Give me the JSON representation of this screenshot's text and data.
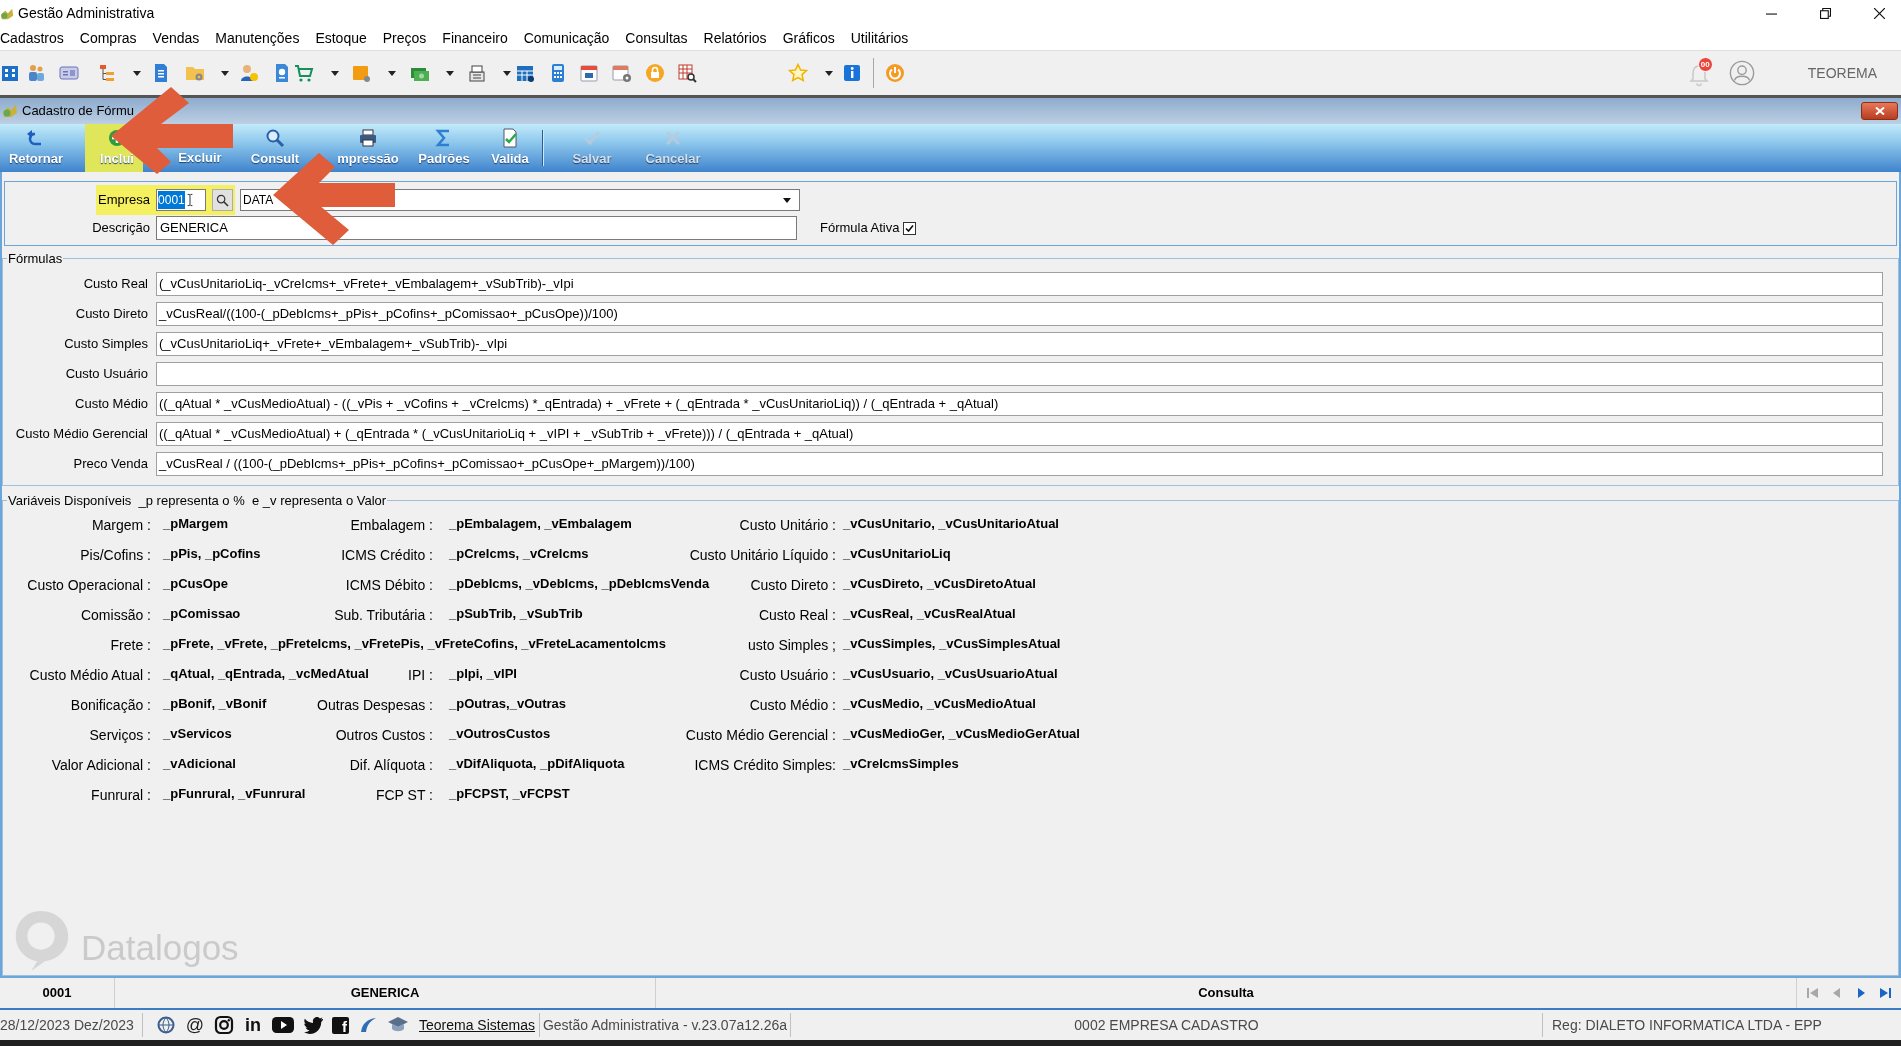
{
  "window": {
    "title": "Gestão Administrativa"
  },
  "menu": [
    "Cadastros",
    "Compras",
    "Vendas",
    "Manutenções",
    "Estoque",
    "Preços",
    "Financeiro",
    "Comunicação",
    "Consultas",
    "Relatórios",
    "Gráficos",
    "Utilitários"
  ],
  "header": {
    "notification_count": "00",
    "user": "TEOREMA"
  },
  "form_window": {
    "title": "Cadastro de Fórmu",
    "buttons": [
      {
        "label": "Retornar",
        "disabled": false,
        "annotated": false
      },
      {
        "label": "Inclui",
        "disabled": false,
        "annotated": true
      },
      {
        "label": "Excluir",
        "disabled": false,
        "annotated": false
      },
      {
        "label": "Consult",
        "disabled": false,
        "annotated": false
      },
      {
        "label": "mpressão",
        "disabled": false,
        "annotated": false
      },
      {
        "label": "Padrões",
        "disabled": false,
        "annotated": false
      },
      {
        "label": "Valida",
        "disabled": false,
        "annotated": false
      },
      {
        "label": "Salvar",
        "disabled": true,
        "annotated": false
      },
      {
        "label": "Cancelar",
        "disabled": true,
        "annotated": false
      }
    ]
  },
  "empresa": {
    "label": "Empresa",
    "code": "0001",
    "code_selected": true,
    "name": "DATA",
    "annotated": true
  },
  "descricao": {
    "label": "Descrição",
    "value": "GENERICA"
  },
  "formula_ativa": {
    "label": "Fórmula Ativa",
    "checked": true
  },
  "formulas": {
    "legend": "Fórmulas",
    "rows": [
      {
        "label": "Custo Real",
        "value": "(_vCusUnitarioLiq-_vCreIcms+_vFrete+_vEmbalagem+_vSubTrib)-_vIpi"
      },
      {
        "label": "Custo Direto",
        "value": "_vCusReal/((100-(_pDebIcms+_pPis+_pCofins+_pComissao+_pCusOpe))/100)"
      },
      {
        "label": "Custo Simples",
        "value": "(_vCusUnitarioLiq+_vFrete+_vEmbalagem+_vSubTrib)-_vIpi"
      },
      {
        "label": "Custo Usuário"
      },
      {
        "label": "Custo Médio",
        "value": "((_qAtual * _vCusMedioAtual) - ((_vPis + _vCofins + _vCreIcms) *_qEntrada) + _vFrete + (_qEntrada * _vCusUnitarioLiq)) / (_qEntrada + _qAtual)"
      },
      {
        "label": "Custo Médio Gerencial",
        "value": "((_qAtual * _vCusMedioAtual) + (_qEntrada * (_vCusUnitarioLiq + _vIPI + _vSubTrib + _vFrete))) / (_qEntrada + _qAtual)"
      },
      {
        "label": "Preco Venda",
        "value": "_vCusReal / ((100-(_pDebIcms+_pPis+_pCofins+_pComissao+_pCusOpe+_pMargem))/100)"
      }
    ]
  },
  "variables": {
    "legend": "Variáveis Disponíveis  _p representa o %  e _v representa o Valor",
    "rows": [
      [
        {
          "kind": "normal",
          "label": "Margem :",
          "value": "_pMargem"
        },
        {
          "kind": "normal",
          "label": "Embalagem :",
          "value": "_pEmbalagem, _vEmbalagem"
        },
        {
          "kind": "normal",
          "label": "Custo Unitário :",
          "value": "_vCusUnitario, _vCusUnitarioAtual"
        }
      ],
      [
        {
          "kind": "normal",
          "label": "Pis/Cofins :",
          "value": "_pPis, _pCofins"
        },
        {
          "kind": "normal",
          "label": "ICMS Crédito :",
          "value": "_pCreIcms, _vCreIcms"
        },
        {
          "kind": "normal",
          "label": "Custo Unitário Líquido :",
          "value": "_vCusUnitarioLiq"
        }
      ],
      [
        {
          "kind": "normal",
          "label": "Custo Operacional :",
          "value": "_pCusOpe"
        },
        {
          "kind": "normal",
          "label": "ICMS Débito :",
          "value": "_pDebIcms, _vDebIcms, _pDebIcmsVenda"
        },
        {
          "kind": "normal",
          "label": "Custo Direto :",
          "value": "_vCusDireto, _vCusDiretoAtual"
        }
      ],
      [
        {
          "kind": "normal",
          "label": "Comissão :",
          "value": "_pComissao"
        },
        {
          "kind": "normal",
          "label": "Sub. Tributária :",
          "value": "_pSubTrib, _vSubTrib"
        },
        {
          "kind": "normal",
          "label": "Custo Real :",
          "value": "_vCusReal, _vCusRealAtual"
        }
      ],
      [
        {
          "kind": "wide",
          "label": "Frete :",
          "value": "_pFrete, _vFrete, _pFreteIcms, _vFretePis, _vFreteCofins, _vFreteLacamentoIcms"
        },
        {
          "kind": "spanned"
        },
        {
          "kind": "normal",
          "label": "usto Simples ;",
          "value": "_vCusSimples, _vCusSimplesAtual"
        }
      ],
      [
        {
          "kind": "normal",
          "label": "Custo Médio Atual :",
          "value": "_qAtual, _qEntrada, _vcMedAtual"
        },
        {
          "kind": "normal",
          "label": "IPI :",
          "value": "_pIpi, _vIPI"
        },
        {
          "kind": "normal",
          "label": "Custo Usuário :",
          "value": "_vCusUsuario, _vCusUsuarioAtual"
        }
      ],
      [
        {
          "kind": "normal",
          "label": "Bonificação :",
          "value": "_pBonif, _vBonif"
        },
        {
          "kind": "normal",
          "label": "Outras Despesas :",
          "value": "_pOutras,_vOutras"
        },
        {
          "kind": "normal",
          "label": "Custo Médio :",
          "value": "_vCusMedio, _vCusMedioAtual"
        }
      ],
      [
        {
          "kind": "normal",
          "label": "Serviços :",
          "value": "_vServicos"
        },
        {
          "kind": "normal",
          "label": "Outros Custos :",
          "value": "_vOutrosCustos"
        },
        {
          "kind": "normal",
          "label": "Custo Médio Gerencial :",
          "value": "_vCusMedioGer, _vCusMedioGerAtual"
        }
      ],
      [
        {
          "kind": "normal",
          "label": "Valor Adicional :",
          "value": "_vAdicional"
        },
        {
          "kind": "normal",
          "label": "Dif. Alíquota :",
          "value": "_vDifAliquota, _pDifAliquota"
        },
        {
          "kind": "normal",
          "label": "ICMS Crédito Simples:",
          "value": "_vCreIcmsSimples"
        }
      ],
      [
        {
          "kind": "normal",
          "label": "Funrural :",
          "value": "_pFunrural, _vFunrural"
        },
        {
          "kind": "normal",
          "label": "FCP ST :",
          "value": "_pFCPST, _vFCPST"
        }
      ]
    ]
  },
  "logo": {
    "text": "Datalogos"
  },
  "record_bar": {
    "code": "0001",
    "description": "GENERICA",
    "mode": "Consulta",
    "navigation": [
      {
        "disabled": true
      },
      {
        "disabled": true
      },
      {
        "disabled": false
      },
      {
        "disabled": false
      }
    ]
  },
  "status_bar": {
    "date": "28/12/2023 Dez/2023",
    "links": [
      {
        "kind": "globe"
      },
      {
        "kind": "glyph",
        "text": "@"
      },
      {
        "kind": "camera"
      },
      {
        "kind": "bold_glyph",
        "text": "in"
      },
      {
        "kind": "play"
      },
      {
        "kind": "bird"
      },
      {
        "kind": "tile",
        "text": "f"
      },
      {
        "kind": "swoosh"
      },
      {
        "kind": "cap"
      }
    ],
    "company_link": "Teorema Sistemas",
    "version": "Gestão Administrativa - v.23.07a12.26a",
    "company": "0002 EMPRESA CADASTRO",
    "registration": "Reg: DIALETO INFORMATICA LTDA - EPP"
  }
}
